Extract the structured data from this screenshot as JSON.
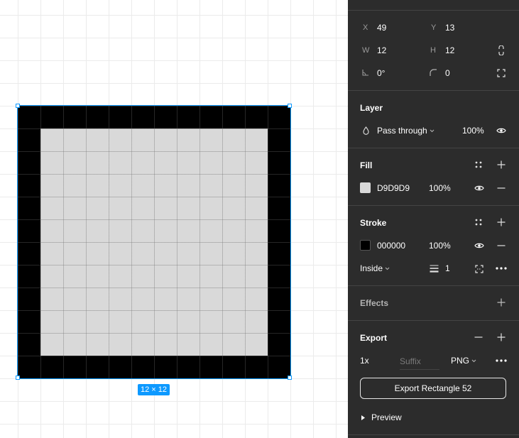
{
  "canvas": {
    "size_badge": "12 × 12"
  },
  "design": {
    "x_label": "X",
    "x_value": "49",
    "y_label": "Y",
    "y_value": "13",
    "w_label": "W",
    "w_value": "12",
    "h_label": "H",
    "h_value": "12",
    "rotation_value": "0°",
    "radius_value": "0"
  },
  "layer": {
    "title": "Layer",
    "blend_mode": "Pass through",
    "opacity": "100%"
  },
  "fill": {
    "title": "Fill",
    "hex": "D9D9D9",
    "opacity": "100%",
    "color": "#D9D9D9"
  },
  "stroke": {
    "title": "Stroke",
    "hex": "000000",
    "opacity": "100%",
    "color": "#000000",
    "position": "Inside",
    "weight": "1"
  },
  "effects": {
    "title": "Effects"
  },
  "export": {
    "title": "Export",
    "scale": "1x",
    "suffix_placeholder": "Suffix",
    "format": "PNG",
    "button_label": "Export Rectangle 52",
    "preview_label": "Preview"
  },
  "colors": {
    "accent": "#0d99ff",
    "panel_bg": "#2c2c2c",
    "divider": "#444444"
  }
}
